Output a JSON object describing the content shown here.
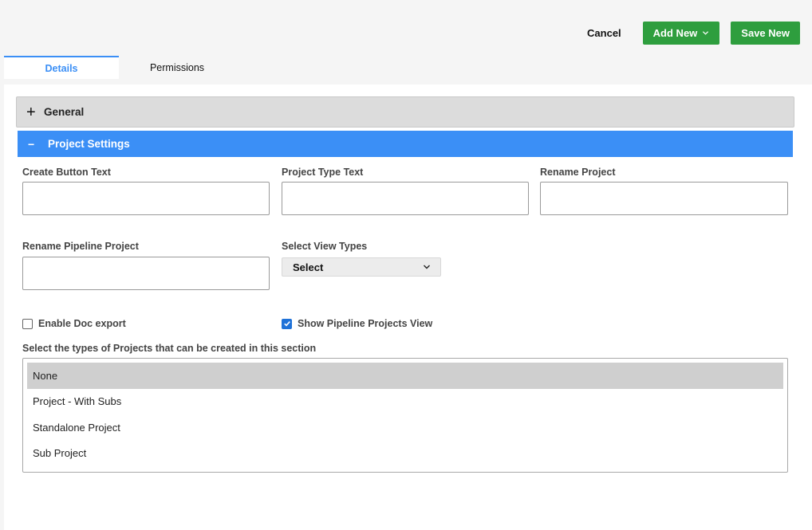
{
  "toolbar": {
    "cancel_label": "Cancel",
    "add_new_label": "Add New",
    "save_new_label": "Save New"
  },
  "tabs": [
    {
      "label": "Details",
      "active": true
    },
    {
      "label": "Permissions",
      "active": false
    }
  ],
  "sections": {
    "general": {
      "title": "General",
      "state_symbol": "+"
    },
    "project_settings": {
      "title": "Project Settings",
      "state_symbol": "−"
    }
  },
  "fields": {
    "create_button_text": {
      "label": "Create Button Text",
      "value": ""
    },
    "project_type_text": {
      "label": "Project Type Text",
      "value": ""
    },
    "rename_project": {
      "label": "Rename Project",
      "value": ""
    },
    "rename_pipeline_project": {
      "label": "Rename Pipeline Project",
      "value": ""
    },
    "select_view_types": {
      "label": "Select View Types",
      "value": "Select"
    }
  },
  "checkboxes": {
    "enable_doc_export": {
      "label": "Enable Doc export",
      "checked": false
    },
    "show_pipeline_projects_view": {
      "label": "Show Pipeline Projects View",
      "checked": true
    }
  },
  "project_types": {
    "label": "Select the types of Projects that can be created in this section",
    "options": [
      {
        "label": "None",
        "selected": true
      },
      {
        "label": "Project - With Subs",
        "selected": false
      },
      {
        "label": "Standalone Project",
        "selected": false
      },
      {
        "label": "Sub Project",
        "selected": false
      }
    ]
  },
  "colors": {
    "accent_blue": "#3b8ff6",
    "button_green": "#2e9e3e",
    "checkbox_blue": "#1f72d8"
  },
  "icons": [
    "chevron-down-icon",
    "plus-icon",
    "minus-icon",
    "checkmark-icon"
  ]
}
